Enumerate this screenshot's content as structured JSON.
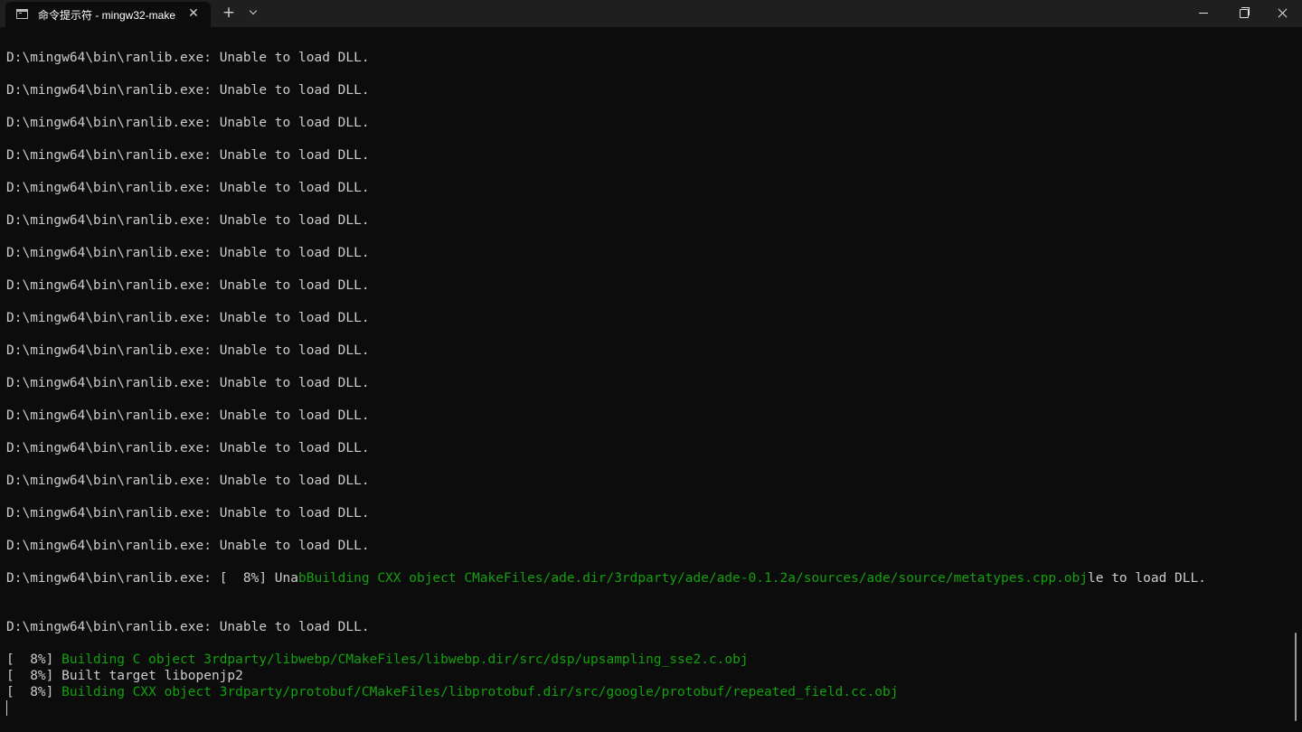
{
  "tab": {
    "title": "命令提示符 - mingw32-make",
    "icon": "terminal-icon"
  },
  "controls": {
    "close_tab": "✕",
    "new_tab": "+",
    "dropdown_icon": "chevron-down-icon",
    "minimize_icon": "minimize-icon",
    "maximize_icon": "restore-icon",
    "close_window_icon": "close-icon"
  },
  "colors": {
    "background": "#0c0c0c",
    "text": "#cccccc",
    "green": "#13a10e"
  },
  "terminal": {
    "error_line": "D:\\mingw64\\bin\\ranlib.exe: Unable to load DLL.",
    "mixed_line": {
      "a": "D:\\mingw64\\bin\\ranlib.exe: [  8%] Una",
      "b": "bBuilding CXX object CMakeFiles/ade.dir/3rdparty/ade/ade-0.1.2a/sources/ade/source/metatypes.cpp.obj",
      "c": "le to load DLL."
    },
    "after_line": "D:\\mingw64\\bin\\ranlib.exe: Unable to load DLL.",
    "build1": {
      "prefix": "[  8%] ",
      "text": "Building C object 3rdparty/libwebp/CMakeFiles/libwebp.dir/src/dsp/upsampling_sse2.c.obj"
    },
    "build2": {
      "prefix": "[  8%] ",
      "text": "Built target libopenjp2"
    },
    "build3": {
      "prefix": "[  8%] ",
      "text": "Building CXX object 3rdparty/protobuf/CMakeFiles/libprotobuf.dir/src/google/protobuf/repeated_field.cc.obj"
    }
  }
}
